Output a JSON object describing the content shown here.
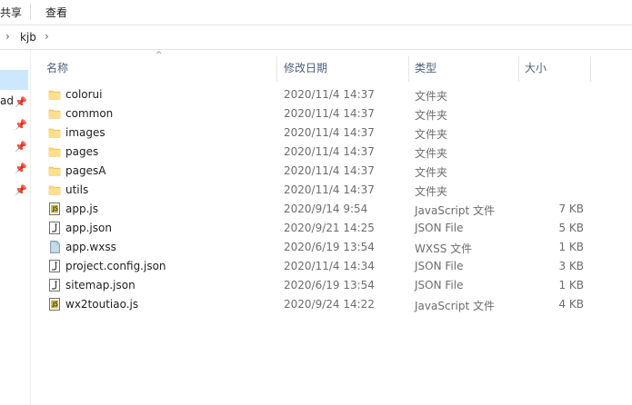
{
  "ribbon": {
    "tab_share": "共享",
    "tab_view": "查看"
  },
  "address": {
    "crumb": "kjb"
  },
  "nav": {
    "quick_item": "ad"
  },
  "columns": {
    "name": "名称",
    "date": "修改日期",
    "type": "类型",
    "size": "大小"
  },
  "files": [
    {
      "name": "colorui",
      "date": "2020/11/4 14:37",
      "type": "文件夹",
      "size": "",
      "icon": "folder-icon"
    },
    {
      "name": "common",
      "date": "2020/11/4 14:37",
      "type": "文件夹",
      "size": "",
      "icon": "folder-icon"
    },
    {
      "name": "images",
      "date": "2020/11/4 14:37",
      "type": "文件夹",
      "size": "",
      "icon": "folder-icon"
    },
    {
      "name": "pages",
      "date": "2020/11/4 14:37",
      "type": "文件夹",
      "size": "",
      "icon": "folder-icon"
    },
    {
      "name": "pagesA",
      "date": "2020/11/4 14:37",
      "type": "文件夹",
      "size": "",
      "icon": "folder-icon"
    },
    {
      "name": "utils",
      "date": "2020/11/4 14:37",
      "type": "文件夹",
      "size": "",
      "icon": "folder-icon"
    },
    {
      "name": "app.js",
      "date": "2020/9/14 9:54",
      "type": "JavaScript 文件",
      "size": "7 KB",
      "icon": "js-file-icon"
    },
    {
      "name": "app.json",
      "date": "2020/9/21 14:25",
      "type": "JSON File",
      "size": "5 KB",
      "icon": "json-file-icon"
    },
    {
      "name": "app.wxss",
      "date": "2020/6/19 13:54",
      "type": "WXSS 文件",
      "size": "1 KB",
      "icon": "wxss-file-icon"
    },
    {
      "name": "project.config.json",
      "date": "2020/11/4 14:34",
      "type": "JSON File",
      "size": "3 KB",
      "icon": "json-file-icon"
    },
    {
      "name": "sitemap.json",
      "date": "2020/6/19 13:54",
      "type": "JSON File",
      "size": "1 KB",
      "icon": "json-file-icon"
    },
    {
      "name": "wx2toutiao.js",
      "date": "2020/9/24 14:22",
      "type": "JavaScript 文件",
      "size": "4 KB",
      "icon": "js-file-icon"
    }
  ]
}
